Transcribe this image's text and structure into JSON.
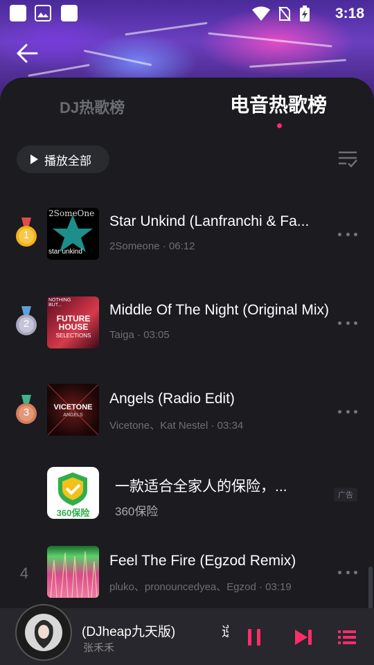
{
  "status_bar": {
    "time": "3:18"
  },
  "tabs": [
    {
      "label": "DJ热歌榜",
      "active": false
    },
    {
      "label": "电音热歌榜",
      "active": true
    }
  ],
  "toolbar": {
    "play_all_label": "播放全部"
  },
  "songs": [
    {
      "rank": "1",
      "medal": "gold",
      "title": "Star Unkind (Lanfranchi & Fa...",
      "artist": "2Someone",
      "duration": "06:12",
      "cover_text_top": "2SomeOne",
      "cover_text_bottom": "star unkind"
    },
    {
      "rank": "2",
      "medal": "silver",
      "title": "Middle Of The Night (Original Mix)",
      "artist": "Taiga",
      "duration": "03:05",
      "cover_text_top": "NOTHING BUT...",
      "cover_text_main": "FUTURE HOUSE",
      "cover_text_sub": "SELECTIONS"
    },
    {
      "rank": "3",
      "medal": "bronze",
      "title": "Angels (Radio Edit)",
      "artist": "Vicetone、Kat Nestel",
      "duration": "03:34",
      "cover_text_main": "VICETONE",
      "cover_text_sub": "ANGELS"
    },
    {
      "rank": "4",
      "medal": "",
      "title": "Feel The Fire (Egzod Remix)",
      "artist": "pluko、pronouncedyea、Egzod",
      "duration": "03:19"
    }
  ],
  "ad": {
    "title": "一款适合全家人的保险，...",
    "source": "360保险",
    "tag": "广告",
    "logo_text": "360保险"
  },
  "player": {
    "title": "(DJheap九天版)",
    "title_cut": "逆",
    "artist": "张禾禾"
  },
  "colors": {
    "accent": "#ff2d6a",
    "background": "#1b1b20",
    "player_bg": "#27272d"
  }
}
